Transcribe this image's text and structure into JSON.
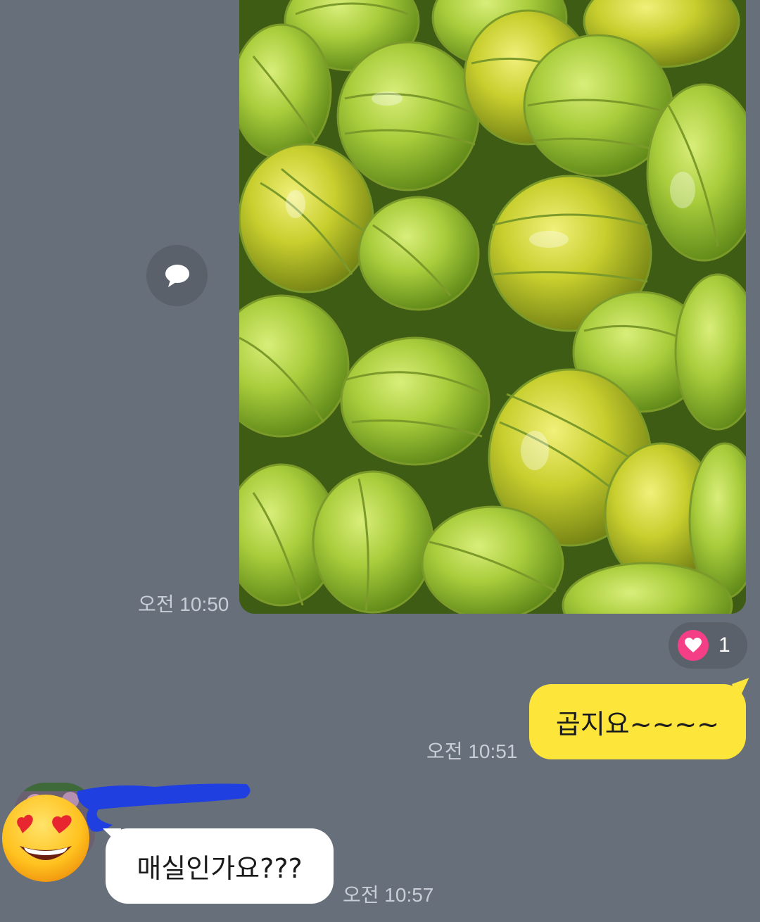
{
  "messages": {
    "photo": {
      "time": "오전 10:50",
      "reaction_count": "1"
    },
    "outgoing": {
      "text": "곱지요~~~~",
      "time": "오전 10:51"
    },
    "incoming": {
      "text": "매실인가요???",
      "time": "오전 10:57"
    }
  },
  "icons": {
    "share": "speech-bubble-icon",
    "reaction": "heart-icon",
    "sticker": "heart-eyes-emoji"
  },
  "colors": {
    "background": "#676f7a",
    "outgoing_bubble": "#fee53a",
    "incoming_bubble": "#ffffff",
    "reaction_badge": "#f43f86",
    "timestamp": "#c9ced6"
  }
}
